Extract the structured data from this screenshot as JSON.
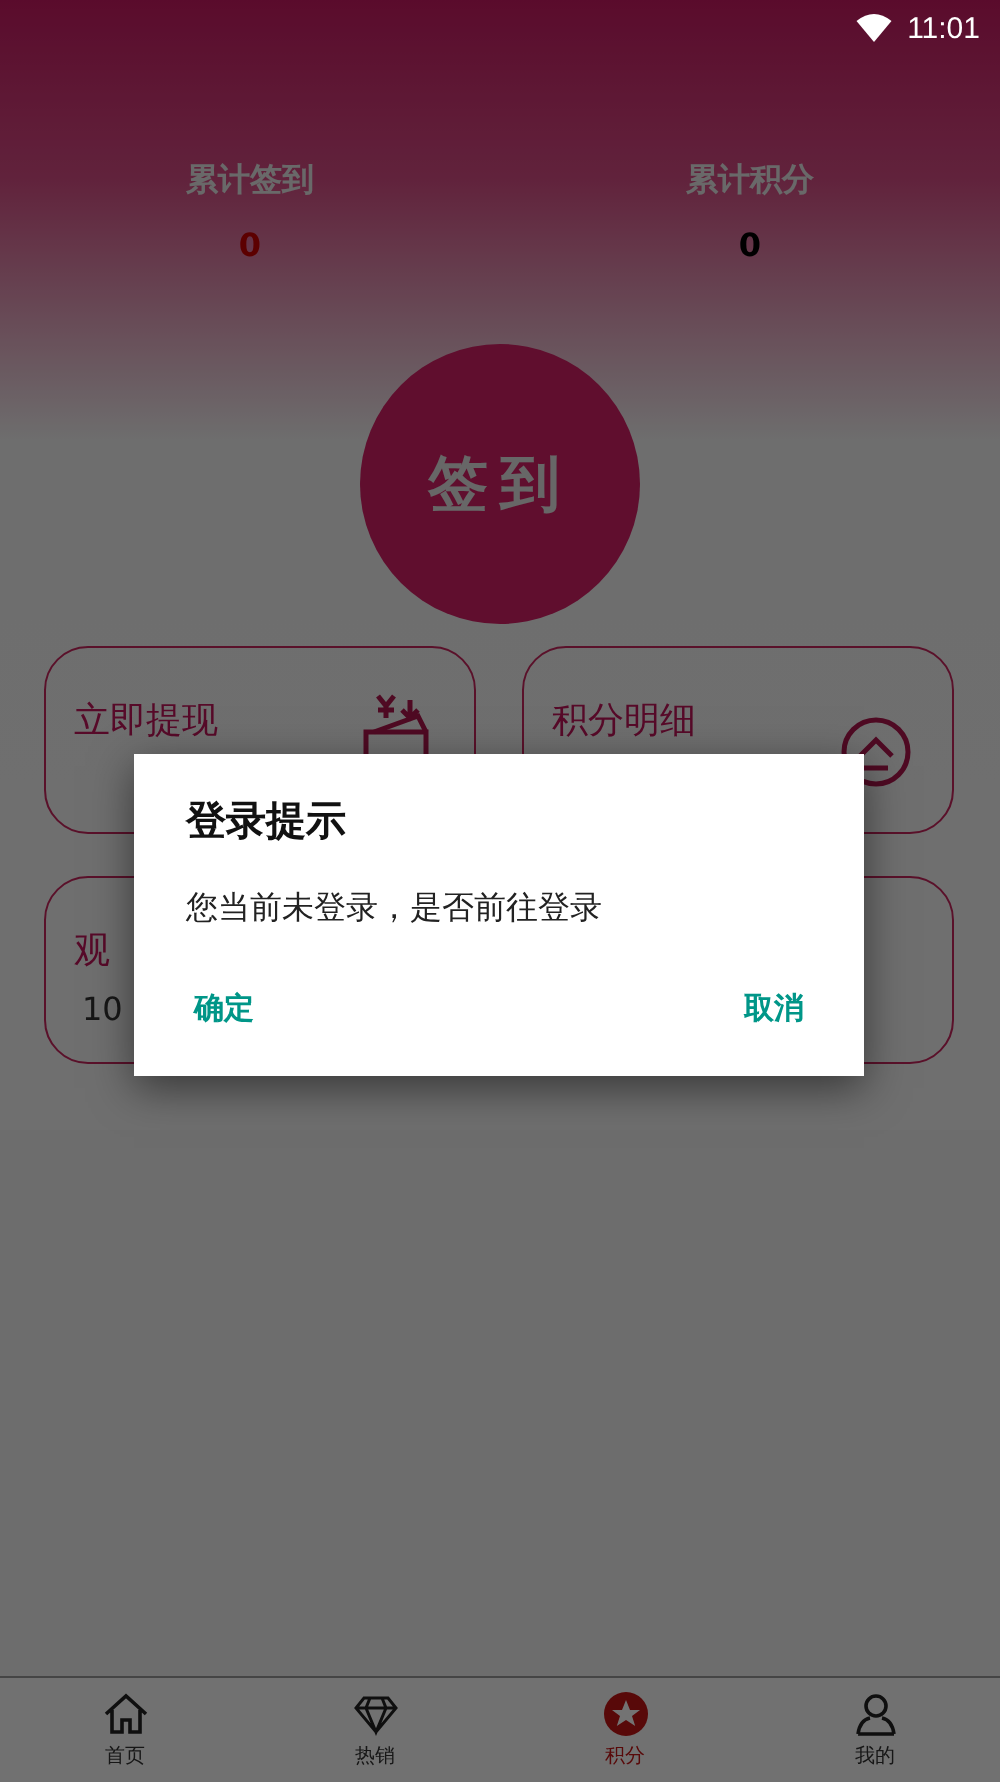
{
  "status_bar": {
    "time": "11:01"
  },
  "stats": [
    {
      "label": "累计签到",
      "value": "0",
      "kind": "accent"
    },
    {
      "label": "累计积分",
      "value": "0",
      "kind": "plain"
    }
  ],
  "sign_button": {
    "label": "签到"
  },
  "cards": [
    {
      "kind": "tile",
      "title": "立即提现"
    },
    {
      "kind": "tile",
      "title": "积分明细"
    },
    {
      "kind": "tile",
      "title": "观",
      "subtitle": "10"
    },
    {
      "kind": "tile"
    }
  ],
  "dialog": {
    "title": "登录提示",
    "message": "您当前未登录，是否前往登录",
    "confirm": "确定",
    "cancel": "取消"
  },
  "tabs": [
    {
      "label": "首页",
      "selected": false
    },
    {
      "label": "热销",
      "selected": false
    },
    {
      "label": "积分",
      "selected": true
    },
    {
      "label": "我的",
      "selected": false
    }
  ]
}
